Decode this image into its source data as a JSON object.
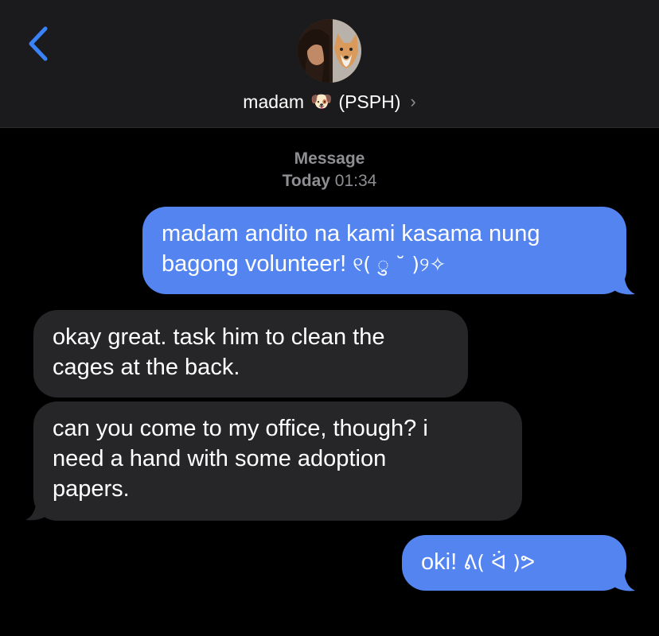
{
  "header": {
    "contact_name": "madam",
    "contact_emoji": "🐶",
    "contact_org": "(PSPH)",
    "chevron": "›",
    "back_icon": "chevron-left-icon",
    "accent_color": "#3a82f7"
  },
  "thread": {
    "service_label": "Message",
    "day_label": "Today",
    "time_label": "01:34"
  },
  "messages": [
    {
      "from": "me",
      "line1": "madam andito na kami kasama nung",
      "line2": "bagong volunteer!",
      "kaomoji": "୧( ु ˘ )୨✧"
    },
    {
      "from": "them",
      "line1": "okay great. task him to clean the",
      "line2": "cages at the back."
    },
    {
      "from": "them",
      "line1": "can you come to my office, though? i",
      "line2": "need a hand with some adoption",
      "line3": "papers."
    },
    {
      "from": "me",
      "text": "oki!",
      "kaomoji": "ᕕ( ᐛ )ᕗ"
    }
  ],
  "colors": {
    "sent_bubble": "#5384f0",
    "received_bubble": "#262628",
    "header_bg": "#1b1b1d",
    "background": "#000000"
  }
}
